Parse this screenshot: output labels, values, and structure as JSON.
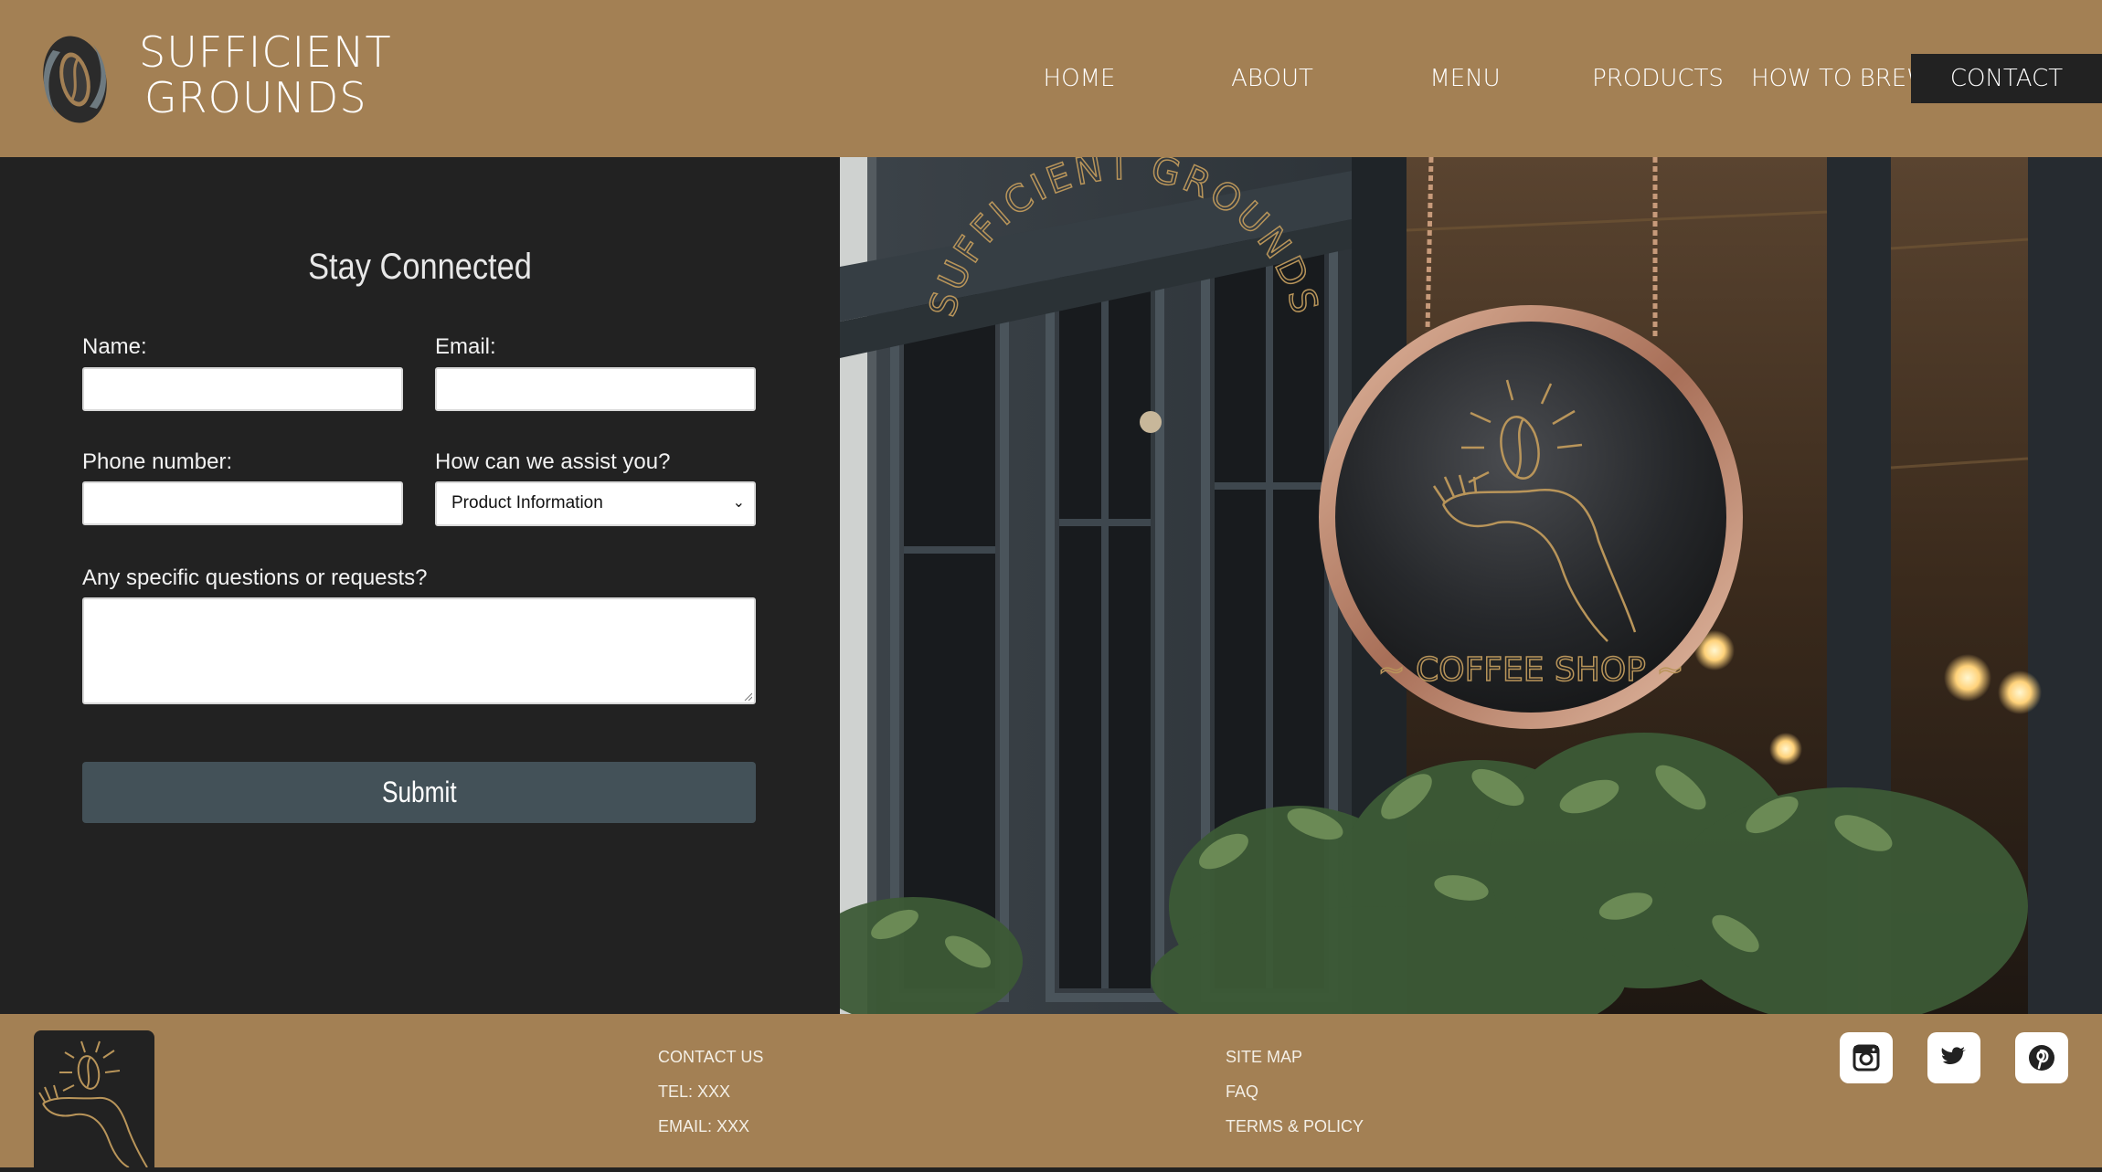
{
  "brand": {
    "line1": "SUFFICIENT",
    "line2": "GROUNDS"
  },
  "nav": {
    "items": [
      {
        "label": "HOME"
      },
      {
        "label": "ABOUT"
      },
      {
        "label": "MENU"
      },
      {
        "label": "PRODUCTS"
      },
      {
        "label": "HOW TO BREW"
      },
      {
        "label": "CONTACT",
        "active": true
      }
    ]
  },
  "form": {
    "title": "Stay Connected",
    "name_label": "Name:",
    "name_value": "",
    "email_label": "Email:",
    "email_value": "",
    "phone_label": "Phone number:",
    "phone_value": "",
    "assist_label": "How can we assist you?",
    "assist_selected": "Product Information",
    "questions_label": "Any specific questions or requests?",
    "questions_value": "",
    "submit_label": "Submit"
  },
  "sign": {
    "arc_text": "SUFFICIENT GROUNDS",
    "bottom_text": "~ COFFEE SHOP ~"
  },
  "footer": {
    "col1": [
      "CONTACT US",
      "TEL: XXX",
      "EMAIL: XXX"
    ],
    "col2": [
      "SITE MAP",
      "FAQ",
      "TERMS & POLICY"
    ],
    "social": [
      "instagram-icon",
      "twitter-icon",
      "pinterest-icon"
    ]
  },
  "colors": {
    "brand_tan": "#a38054",
    "dark": "#222222",
    "submit": "#435158",
    "gold": "#c9a55a"
  }
}
